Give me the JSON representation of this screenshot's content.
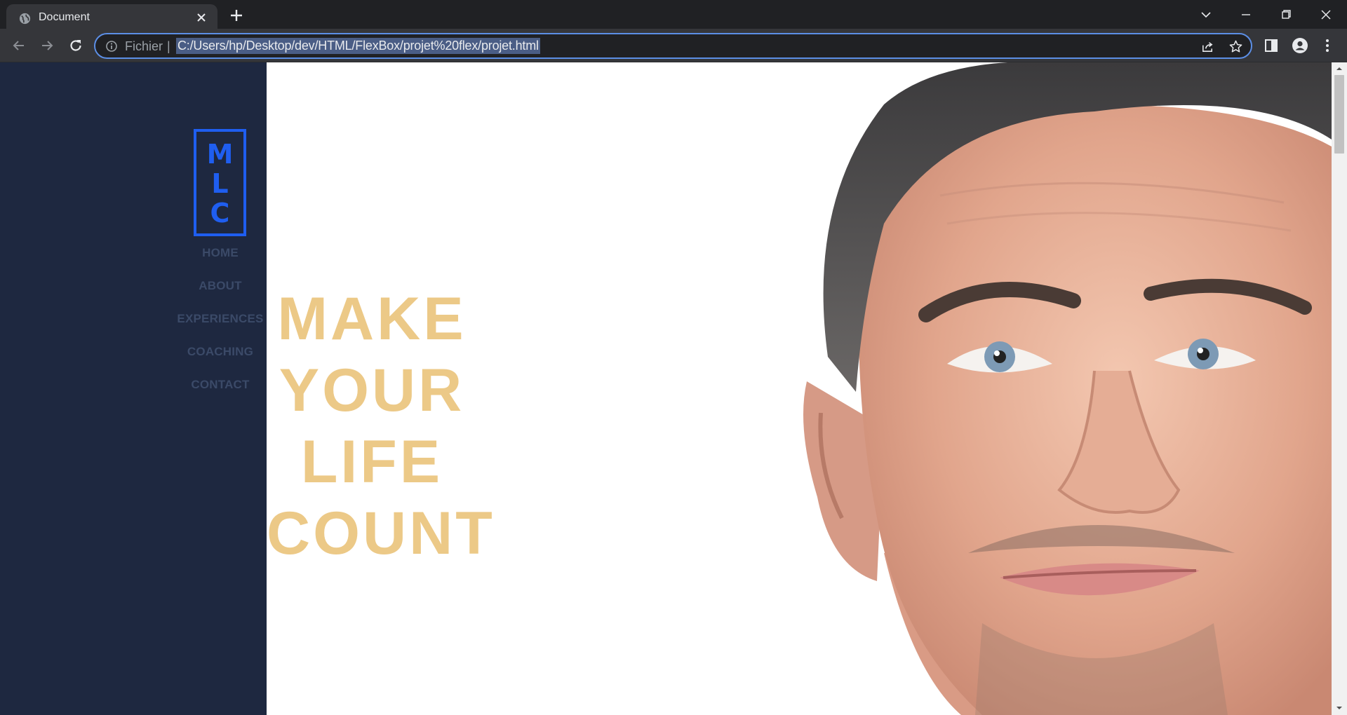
{
  "browser": {
    "tab_title": "Document",
    "omnibox": {
      "scheme_label": "Fichier",
      "separator": "|",
      "url": "C:/Users/hp/Desktop/dev/HTML/FlexBox/projet%20flex/projet.html"
    }
  },
  "page": {
    "logo": {
      "letters": [
        "M",
        "L",
        "C"
      ]
    },
    "nav": [
      "HOME",
      "ABOUT",
      "EXPERIENCES",
      "COACHING",
      "CONTACT"
    ],
    "hero": [
      "MAKE",
      "YOUR",
      "LIFE",
      "COUNT"
    ]
  },
  "colors": {
    "sidebar_bg": "#1e2840",
    "logo_blue": "#1f5ef0",
    "nav_text": "#3b4a68",
    "hero_gold": "#ecc987",
    "url_highlight": "#4a5d85"
  },
  "icons": {
    "tab": [
      "globe-icon",
      "close-icon"
    ],
    "toolbar": [
      "back-arrow-icon",
      "forward-arrow-icon",
      "reload-icon",
      "info-icon",
      "share-icon",
      "star-icon",
      "side-panel-icon",
      "profile-icon",
      "menu-dots-icon"
    ],
    "window": [
      "chevron-down-icon",
      "minimize-icon",
      "restore-icon",
      "close-window-icon"
    ]
  }
}
